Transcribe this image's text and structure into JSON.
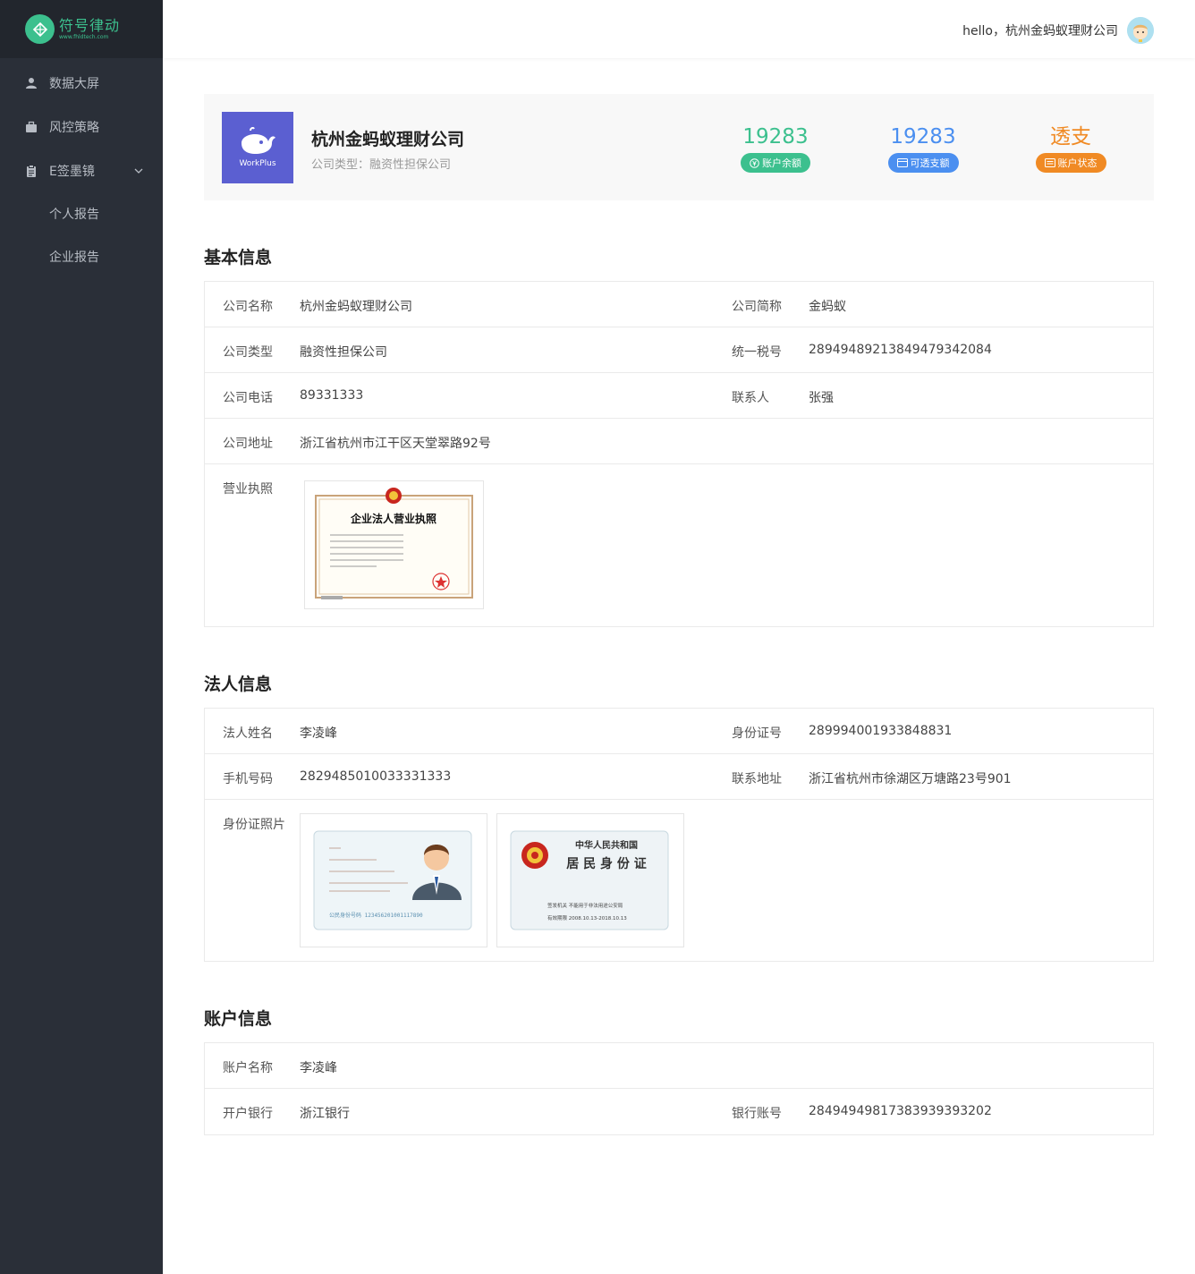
{
  "brand": {
    "name": "符号律动",
    "url": "www.fhldtech.com",
    "color": "#3cc08e"
  },
  "sidebar": {
    "items": [
      {
        "label": "数据大屏",
        "icon": "user-icon"
      },
      {
        "label": "风控策略",
        "icon": "briefcase-icon"
      },
      {
        "label": "E签墨镜",
        "icon": "clipboard-icon",
        "expanded": true
      }
    ],
    "subitems": [
      {
        "label": "个人报告"
      },
      {
        "label": "企业报告"
      }
    ]
  },
  "header": {
    "greeting": "hello，杭州金蚂蚁理财公司"
  },
  "summary": {
    "logo_text": "WorkPlus",
    "company_name": "杭州金蚂蚁理财公司",
    "company_type": "公司类型：融资性担保公司",
    "stats": [
      {
        "value": "19283",
        "label": "账户余额",
        "color": "#3cc08e",
        "icon": "yen-icon"
      },
      {
        "value": "19283",
        "label": "可透支额",
        "color": "#4b8ff0",
        "icon": "card-icon"
      },
      {
        "value": "透支",
        "label": "账户状态",
        "color": "#f08a24",
        "icon": "status-icon"
      }
    ]
  },
  "basic": {
    "title": "基本信息",
    "name_label": "公司名称",
    "name": "杭州金蚂蚁理财公司",
    "short_label": "公司简称",
    "short": "金蚂蚁",
    "type_label": "公司类型",
    "type": "融资性担保公司",
    "tax_label": "统一税号",
    "tax": "289494892138494793420​84",
    "phone_label": "公司电话",
    "phone": "89331333",
    "contact_label": "联系人",
    "contact": "张强",
    "address_label": "公司地址",
    "address": "浙江省杭州市江干区天堂翠路92号",
    "license_label": "营业执照",
    "license_title": "企业法人营业执照"
  },
  "legal": {
    "title": "法人信息",
    "name_label": "法人姓名",
    "name": "李凌峰",
    "id_label": "身份证号",
    "id": "289994001933848831",
    "mobile_label": "手机号码",
    "mobile": "2829485010033331333",
    "addr_label": "联系地址",
    "addr": "浙江省杭州市徐湖区万塘路23号901",
    "photo_label": "身份证照片",
    "id_back_line1": "中华人民共和国",
    "id_back_line2": "居 民 身 份 证",
    "id_back_issuer": "签发机关  不能用于非法用途公安局",
    "id_back_valid": "有效期限  2008.10.13-2018.10.13",
    "id_front_number": "123456201001117890"
  },
  "account": {
    "title": "账户信息",
    "name_label": "账户名称",
    "name": "李凌峰",
    "bank_label": "开户银行",
    "bank": "浙江银行",
    "acct_label": "银行账号",
    "acct": "2849494981738393939​3202"
  }
}
